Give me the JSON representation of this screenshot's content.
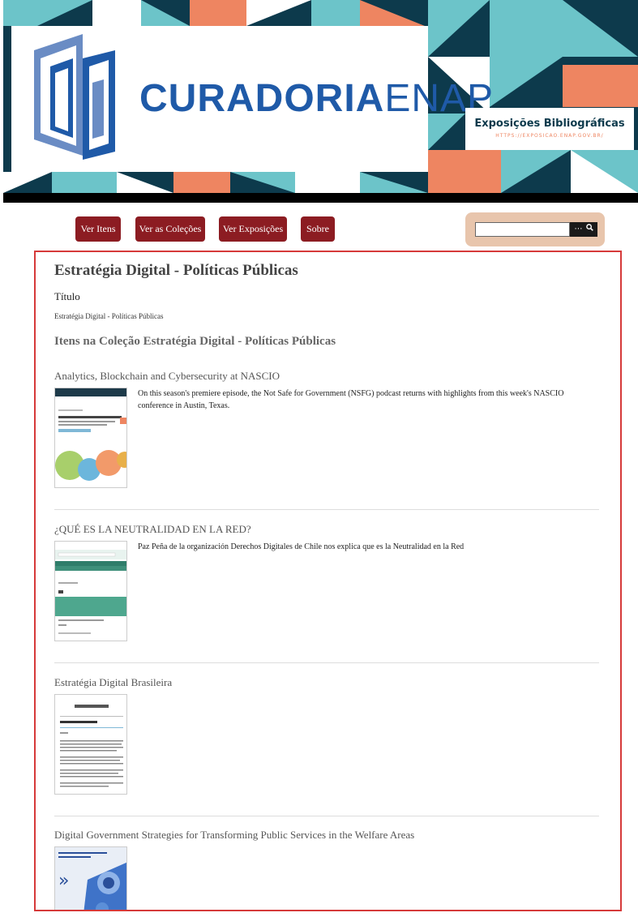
{
  "banner": {
    "logo_strong": "CURADORIA",
    "logo_light": "ENAP",
    "expo_title": "Exposições Bibliográficas",
    "expo_url": "HTTPS://EXPOSICAO.ENAP.GOV.BR/",
    "colors": {
      "navy": "#0d3a4c",
      "teal": "#6cc4c9",
      "salmon": "#ee8561",
      "logo_blue": "#1f5aa8"
    }
  },
  "nav": {
    "items": [
      {
        "label": "Ver Itens"
      },
      {
        "label": "Ver as Coleções"
      },
      {
        "label": "Ver Exposições"
      },
      {
        "label": "Sobre"
      }
    ],
    "button_color": "#8c1c22",
    "search": {
      "placeholder": "",
      "options_icon": "ellipsis-icon",
      "submit_icon": "search-icon"
    }
  },
  "collection": {
    "title": "Estratégia Digital - Políticas Públicas",
    "field_label": "Título",
    "field_value": "Estratégia Digital - Políticas Públicas",
    "items_heading": "Itens na Coleção Estratégia Digital - Políticas Públicas"
  },
  "items": [
    {
      "title": "Analytics, Blockchain and Cybersecurity at NASCIO",
      "description": "On this season's premiere episode, the Not Safe for Government (NSFG) podcast returns with highlights from this week's NASCIO conference in Austin, Texas."
    },
    {
      "title": "¿QUÉ ES LA NEUTRALIDAD EN LA RED?",
      "description": "Paz Peña de la organización Derechos Digitales de Chile nos explica que es la Neutralidad en la Red"
    },
    {
      "title": "Estratégia Digital Brasileira",
      "description": ""
    },
    {
      "title": "Digital Government Strategies for Transforming Public Services in the Welfare Areas",
      "description": ""
    }
  ]
}
